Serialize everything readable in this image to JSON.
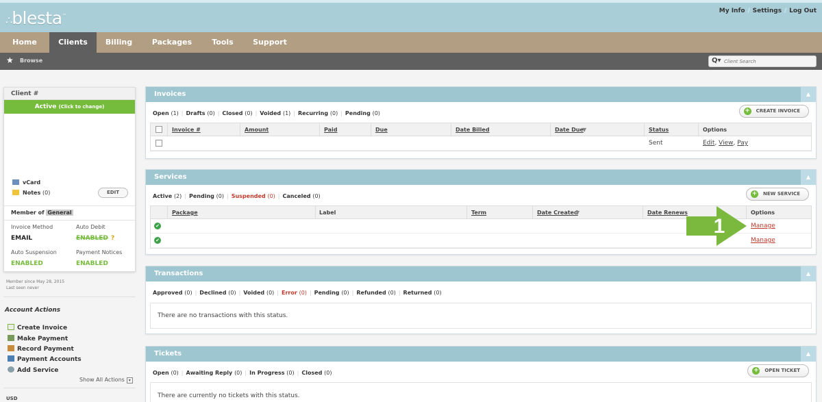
{
  "header": {
    "logo": "blesta",
    "logo_mark": "™",
    "links": [
      "My Info",
      "Settings",
      "Log Out"
    ],
    "link_sep": "/"
  },
  "nav": {
    "tabs": [
      "Home",
      "Clients",
      "Billing",
      "Packages",
      "Tools",
      "Support"
    ],
    "active": "Clients"
  },
  "subnav": {
    "browse": "Browse",
    "search_placeholder": "Client Search"
  },
  "client_card": {
    "title": "Client #",
    "status": "Active",
    "status_hint": "(Click to change)",
    "vcard": "vCard",
    "notes": "Notes",
    "notes_count": "(0)",
    "edit": "EDIT",
    "member_of": "Member of",
    "group": "General",
    "invoice_method_label": "Invoice Method",
    "invoice_method": "EMAIL",
    "auto_debit_label": "Auto Debit",
    "auto_debit": "ENABLED",
    "auto_debit_help": "?",
    "auto_suspension_label": "Auto Suspension",
    "auto_suspension": "ENABLED",
    "payment_notices_label": "Payment Notices",
    "payment_notices": "ENABLED"
  },
  "member_since": "Member since May 28, 2015",
  "last_seen": "Last seen never",
  "account_actions": {
    "title": "Account Actions",
    "items": [
      "Create Invoice",
      "Make Payment",
      "Record Payment",
      "Payment Accounts",
      "Add Service"
    ],
    "show_all": "Show All Actions"
  },
  "currency": "USD",
  "invoices": {
    "title": "Invoices",
    "filters": [
      {
        "label": "Open",
        "count": "(1)"
      },
      {
        "label": "Drafts",
        "count": "(0)"
      },
      {
        "label": "Closed",
        "count": "(0)"
      },
      {
        "label": "Voided",
        "count": "(1)"
      },
      {
        "label": "Recurring",
        "count": "(0)"
      },
      {
        "label": "Pending",
        "count": "(0)"
      }
    ],
    "button": "CREATE INVOICE",
    "columns": [
      "Invoice #",
      "Amount",
      "Paid",
      "Due",
      "Date Billed",
      "Date Due",
      "Status",
      "Options"
    ],
    "row": {
      "status": "Sent",
      "edit": "Edit",
      "view": "View",
      "pay": "Pay"
    }
  },
  "services": {
    "title": "Services",
    "filters": [
      {
        "label": "Active",
        "count": "(2)"
      },
      {
        "label": "Pending",
        "count": "(0)"
      },
      {
        "label": "Suspended",
        "count": "(0)"
      },
      {
        "label": "Canceled",
        "count": "(0)"
      }
    ],
    "button": "NEW SERVICE",
    "columns": [
      "Package",
      "Label",
      "Term",
      "Date Created",
      "Date Renews",
      "Options"
    ],
    "rows": [
      {
        "manage": "Manage"
      },
      {
        "manage": "Manage"
      }
    ]
  },
  "transactions": {
    "title": "Transactions",
    "filters": [
      {
        "label": "Approved",
        "count": "(0)"
      },
      {
        "label": "Declined",
        "count": "(0)"
      },
      {
        "label": "Voided",
        "count": "(0)"
      },
      {
        "label": "Error",
        "count": "(0)"
      },
      {
        "label": "Pending",
        "count": "(0)"
      },
      {
        "label": "Refunded",
        "count": "(0)"
      },
      {
        "label": "Returned",
        "count": "(0)"
      }
    ],
    "empty": "There are no transactions with this status."
  },
  "tickets": {
    "title": "Tickets",
    "filters": [
      {
        "label": "Open",
        "count": "(0)"
      },
      {
        "label": "Awaiting Reply",
        "count": "(0)"
      },
      {
        "label": "In Progress",
        "count": "(0)"
      },
      {
        "label": "Closed",
        "count": "(0)"
      }
    ],
    "button": "OPEN TICKET",
    "empty": "There are currently no tickets with this status."
  },
  "callout": {
    "number": "1"
  },
  "colors": {
    "accent": "#9ec6d1",
    "nav": "#b29e83",
    "green": "#76bc3c",
    "red": "#c0392b"
  }
}
